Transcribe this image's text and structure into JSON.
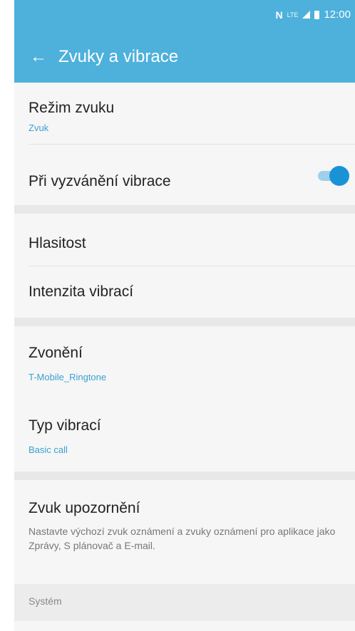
{
  "status": {
    "nfc": "N",
    "network": "LTE",
    "time": "12:00"
  },
  "header": {
    "back_icon": "←",
    "title": "Zvuky a vibrace"
  },
  "items": {
    "sound_mode": {
      "label": "Režim zvuku",
      "value": "Zvuk"
    },
    "vibrate_ring": {
      "label": "Při vyzvánění vibrace",
      "enabled": true
    },
    "volume": {
      "label": "Hlasitost"
    },
    "vibration_intensity": {
      "label": "Intenzita vibrací"
    },
    "ringtone": {
      "label": "Zvonění",
      "value": "T-Mobile_Ringtone"
    },
    "vibration_type": {
      "label": "Typ vibrací",
      "value": "Basic call"
    },
    "notification_sound": {
      "label": "Zvuk upozornění",
      "description": "Nastavte výchozí zvuk oznámení a zvuky oznámení pro aplikace jako Zprávy, S plánovač a E-mail."
    }
  },
  "section": {
    "system": "Systém"
  },
  "colors": {
    "accent": "#4db1dc",
    "link": "#3aa0d0",
    "toggle": "#1a93d6"
  }
}
